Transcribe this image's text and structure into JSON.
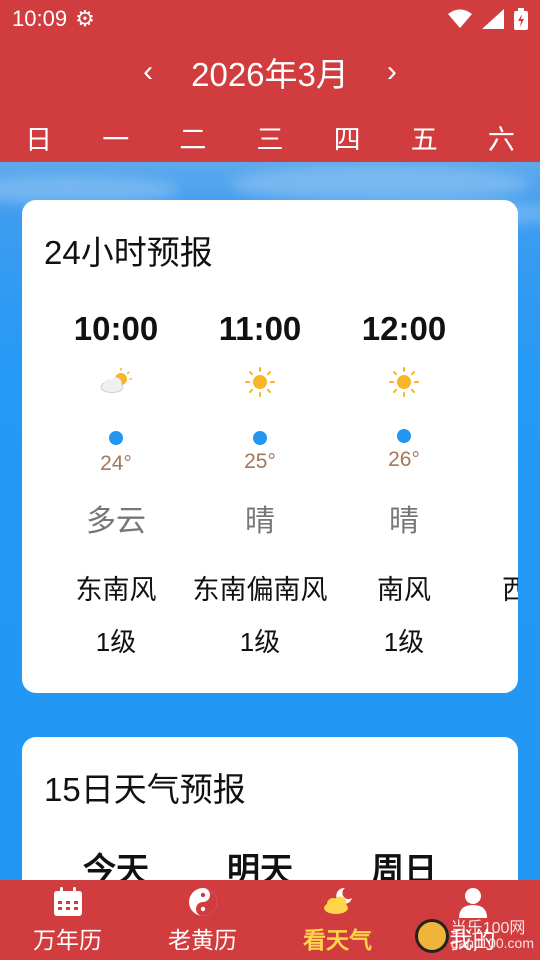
{
  "status_bar": {
    "time": "10:09",
    "icons": [
      "gear-icon",
      "wifi-icon",
      "signal-icon",
      "battery-icon"
    ]
  },
  "header": {
    "prev_arrow": "‹",
    "month_title": "2026年3月",
    "next_arrow": "›",
    "weekdays": [
      "日",
      "一",
      "二",
      "三",
      "四",
      "五",
      "六"
    ]
  },
  "hourly_card": {
    "title": "24小时预报",
    "hours": [
      {
        "time": "10:00",
        "icon": "partly-cloudy-icon",
        "temp": "24°",
        "condition": "多云",
        "wind": "东南风",
        "level": "1级"
      },
      {
        "time": "11:00",
        "icon": "sun-icon",
        "temp": "25°",
        "condition": "晴",
        "wind": "东南偏南风",
        "level": "1级"
      },
      {
        "time": "12:00",
        "icon": "sun-icon",
        "temp": "26°",
        "condition": "晴",
        "wind": "南风",
        "level": "1级"
      },
      {
        "time": "",
        "icon": "",
        "temp": "",
        "condition": "",
        "wind": "西",
        "level": ""
      }
    ]
  },
  "daily_card": {
    "title": "15日天气预报",
    "days": [
      "今天",
      "明天",
      "周日"
    ]
  },
  "bottom_nav": {
    "items": [
      {
        "label": "万年历",
        "icon": "calendar-icon",
        "active": false
      },
      {
        "label": "老黄历",
        "icon": "yin-yang-icon",
        "active": false
      },
      {
        "label": "看天气",
        "icon": "weather-icon",
        "active": true
      },
      {
        "label": "我的",
        "icon": "user-icon",
        "active": false
      }
    ]
  },
  "watermark": {
    "line1": "当乐100网",
    "line2": "danji100.com"
  },
  "colors": {
    "primary_red": "#d13c3e",
    "sky_blue": "#2196f3",
    "active_nav": "#ffd54a",
    "temp_text": "#a5775a"
  }
}
